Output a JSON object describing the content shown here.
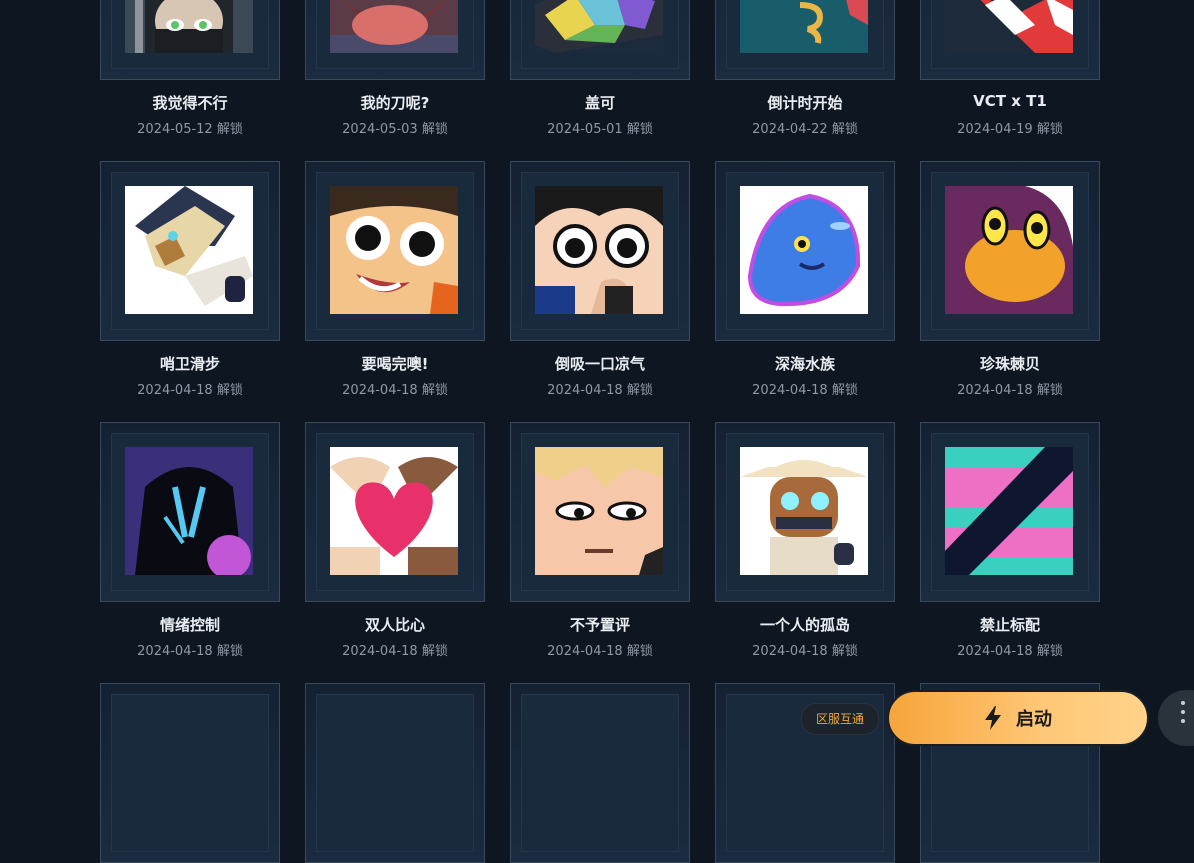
{
  "unlock_suffix": "解锁",
  "rows": [
    {
      "items": [
        {
          "name": "我觉得不行",
          "date": "2024-05-12 解锁",
          "art": "agent-mask"
        },
        {
          "name": "我的刀呢?",
          "date": "2024-05-03 解锁",
          "art": "tongue"
        },
        {
          "name": "盖可",
          "date": "2024-05-01 解锁",
          "art": "graffiti"
        },
        {
          "name": "倒计时开始",
          "date": "2024-04-22 解锁",
          "art": "countdown"
        },
        {
          "name": "VCT x T1",
          "date": "2024-04-19 解锁",
          "art": "t1-logo"
        }
      ]
    },
    {
      "items": [
        {
          "name": "哨卫滑步",
          "date": "2024-04-18 解锁",
          "art": "sentinel"
        },
        {
          "name": "要喝完噢!",
          "date": "2024-04-18 解锁",
          "art": "drink-face"
        },
        {
          "name": "倒吸一口凉气",
          "date": "2024-04-18 解锁",
          "art": "gasp"
        },
        {
          "name": "深海水族",
          "date": "2024-04-18 解锁",
          "art": "sea-creature"
        },
        {
          "name": "珍珠棘贝",
          "date": "2024-04-18 解锁",
          "art": "pearl-shell"
        }
      ]
    },
    {
      "items": [
        {
          "name": "情绪控制",
          "date": "2024-04-18 解锁",
          "art": "shadow-hood"
        },
        {
          "name": "双人比心",
          "date": "2024-04-18 解锁",
          "art": "heart-hands"
        },
        {
          "name": "不予置评",
          "date": "2024-04-18 解锁",
          "art": "unimpressed"
        },
        {
          "name": "一个人的孤岛",
          "date": "2024-04-18 解锁",
          "art": "hat-robot"
        },
        {
          "name": "禁止标配",
          "date": "2024-04-18 解锁",
          "art": "no-classic"
        }
      ]
    }
  ],
  "footer": {
    "region_badge": "区服互通",
    "launch_label": "启动"
  },
  "colors": {
    "background": "#0e1621",
    "frame_border": "#3b4a5b",
    "launch_start": "#f6a53a",
    "launch_end": "#ffd38a",
    "badge_text": "#f0a640"
  }
}
